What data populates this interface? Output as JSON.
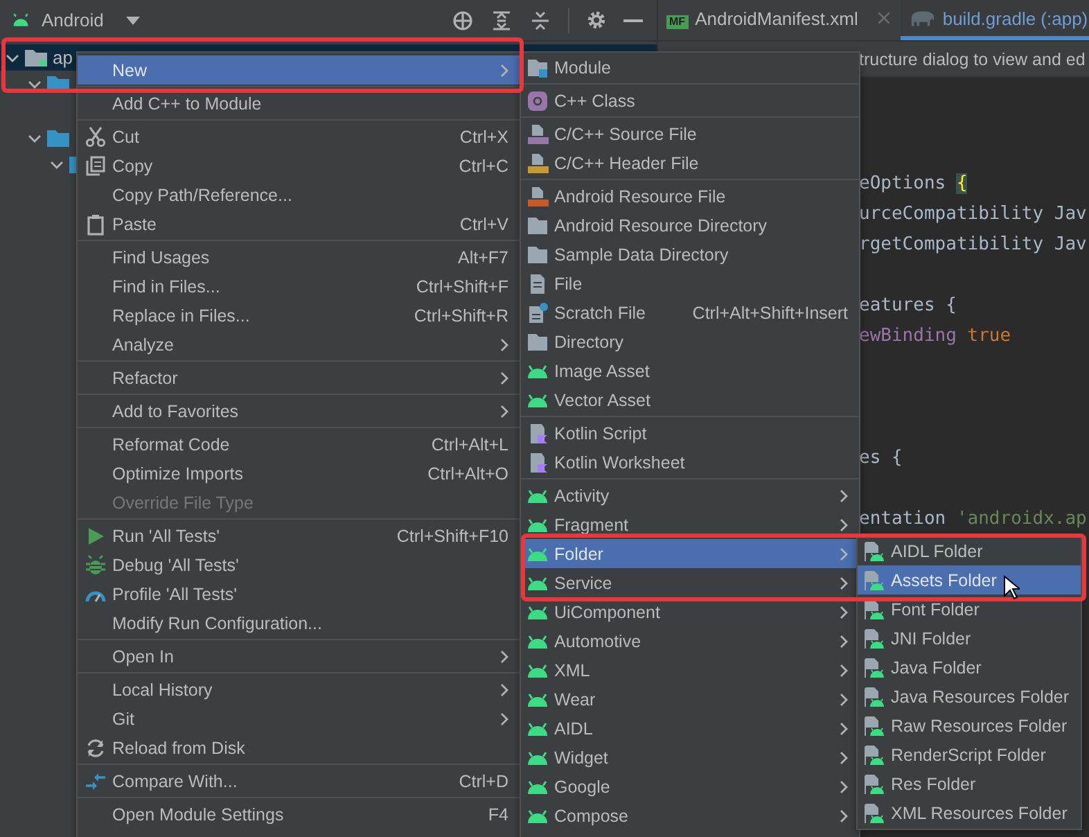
{
  "project_toolbar": {
    "view": "Android"
  },
  "editor_tabs": [
    {
      "label": "AndroidManifest.xml",
      "badge": "MF",
      "kind": "manifest",
      "selected": false
    },
    {
      "label": "build.gradle (:app)",
      "kind": "gradle",
      "selected": true
    }
  ],
  "project_tree": [
    {
      "label": "ap",
      "selected": true,
      "expanded": true,
      "children": [
        {
          "selected": false,
          "expanded": true
        },
        {
          "selected": false,
          "expanded": true,
          "children": [
            {
              "selected": false,
              "expanded": true
            }
          ]
        }
      ]
    }
  ],
  "editor_hint": "tructure dialog to view and ed",
  "code_lines": [
    {
      "kind": "blank"
    },
    {
      "kind": "blank"
    },
    {
      "kind": "blank"
    },
    {
      "kind": "code",
      "tokens": [
        {
          "text": "eOptions "
        },
        {
          "text": "{",
          "kind": "brace-match"
        }
      ]
    },
    {
      "kind": "code",
      "tokens": [
        {
          "text": "urceCompatibility Jav"
        }
      ]
    },
    {
      "kind": "code",
      "tokens": [
        {
          "text": "rgetCompatibility Jav"
        }
      ]
    },
    {
      "kind": "blank"
    },
    {
      "kind": "code",
      "tokens": [
        {
          "text": "eatures {"
        }
      ]
    },
    {
      "kind": "code",
      "tokens": [
        {
          "text": "ewBinding ",
          "kind": "property"
        },
        {
          "text": "true",
          "kind": "keyword"
        }
      ]
    },
    {
      "kind": "blank"
    },
    {
      "kind": "blank"
    },
    {
      "kind": "blank"
    },
    {
      "kind": "code",
      "tokens": [
        {
          "text": "es {"
        }
      ]
    },
    {
      "kind": "blank"
    },
    {
      "kind": "code",
      "tokens": [
        {
          "text": "entation "
        },
        {
          "text": "'androidx.ap",
          "kind": "string"
        }
      ]
    }
  ],
  "context_menu": {
    "groups": [
      [
        {
          "label": "New",
          "selected": true,
          "submenu": true,
          "disabled": false
        }
      ],
      [
        {
          "label": "Add C++ to Module",
          "selected": false,
          "submenu": false,
          "disabled": false
        }
      ],
      [
        {
          "label": "Cut",
          "shortcut": "Ctrl+X",
          "kind": "scissors",
          "selected": false,
          "submenu": false,
          "disabled": false
        },
        {
          "label": "Copy",
          "shortcut": "Ctrl+C",
          "kind": "copy",
          "selected": false,
          "submenu": false,
          "disabled": false
        },
        {
          "label": "Copy Path/Reference...",
          "selected": false,
          "submenu": false,
          "disabled": false
        },
        {
          "label": "Paste",
          "shortcut": "Ctrl+V",
          "kind": "paste",
          "selected": false,
          "submenu": false,
          "disabled": false
        }
      ],
      [
        {
          "label": "Find Usages",
          "shortcut": "Alt+F7",
          "selected": false,
          "submenu": false,
          "disabled": false
        },
        {
          "label": "Find in Files...",
          "shortcut": "Ctrl+Shift+F",
          "selected": false,
          "submenu": false,
          "disabled": false
        },
        {
          "label": "Replace in Files...",
          "shortcut": "Ctrl+Shift+R",
          "selected": false,
          "submenu": false,
          "disabled": false
        },
        {
          "label": "Analyze",
          "selected": false,
          "submenu": true,
          "disabled": false
        }
      ],
      [
        {
          "label": "Refactor",
          "selected": false,
          "submenu": true,
          "disabled": false
        }
      ],
      [
        {
          "label": "Add to Favorites",
          "selected": false,
          "submenu": true,
          "disabled": false
        }
      ],
      [
        {
          "label": "Reformat Code",
          "shortcut": "Ctrl+Alt+L",
          "selected": false,
          "submenu": false,
          "disabled": false
        },
        {
          "label": "Optimize Imports",
          "shortcut": "Ctrl+Alt+O",
          "selected": false,
          "submenu": false,
          "disabled": false
        },
        {
          "label": "Override File Type",
          "selected": false,
          "submenu": false,
          "disabled": true
        }
      ],
      [
        {
          "label": "Run 'All Tests'",
          "shortcut": "Ctrl+Shift+F10",
          "kind": "run",
          "selected": false,
          "submenu": false,
          "disabled": false
        },
        {
          "label": "Debug 'All Tests'",
          "kind": "debug",
          "selected": false,
          "submenu": false,
          "disabled": false
        },
        {
          "label": "Profile 'All Tests'",
          "kind": "profile",
          "selected": false,
          "submenu": false,
          "disabled": false
        },
        {
          "label": "Modify Run Configuration...",
          "selected": false,
          "submenu": false,
          "disabled": false
        }
      ],
      [
        {
          "label": "Open In",
          "selected": false,
          "submenu": true,
          "disabled": false
        }
      ],
      [
        {
          "label": "Local History",
          "selected": false,
          "submenu": true,
          "disabled": false
        },
        {
          "label": "Git",
          "selected": false,
          "submenu": true,
          "disabled": false
        },
        {
          "label": "Reload from Disk",
          "kind": "reload",
          "selected": false,
          "submenu": false,
          "disabled": false
        }
      ],
      [
        {
          "label": "Compare With...",
          "shortcut": "Ctrl+D",
          "kind": "compare",
          "selected": false,
          "submenu": false,
          "disabled": false
        }
      ],
      [
        {
          "label": "Open Module Settings",
          "shortcut": "F4",
          "selected": false,
          "submenu": false,
          "disabled": false
        }
      ]
    ]
  },
  "new_submenu": {
    "groups": [
      [
        {
          "label": "Module",
          "kind": "module",
          "selected": false,
          "submenu": false
        }
      ],
      [
        {
          "label": "C++ Class",
          "kind": "cpp-class",
          "selected": false,
          "submenu": false
        }
      ],
      [
        {
          "label": "C/C++ Source File",
          "kind": "cpp-source",
          "selected": false,
          "submenu": false
        },
        {
          "label": "C/C++ Header File",
          "kind": "cpp-header",
          "selected": false,
          "submenu": false
        }
      ],
      [
        {
          "label": "Android Resource File",
          "kind": "res-file",
          "selected": false,
          "submenu": false
        },
        {
          "label": "Android Resource Directory",
          "kind": "folder",
          "selected": false,
          "submenu": false
        },
        {
          "label": "Sample Data Directory",
          "kind": "folder",
          "selected": false,
          "submenu": false
        },
        {
          "label": "File",
          "kind": "file",
          "selected": false,
          "submenu": false
        },
        {
          "label": "Scratch File",
          "shortcut": "Ctrl+Alt+Shift+Insert",
          "kind": "scratch",
          "selected": false,
          "submenu": false
        },
        {
          "label": "Directory",
          "kind": "folder",
          "selected": false,
          "submenu": false
        },
        {
          "label": "Image Asset",
          "kind": "android",
          "selected": false,
          "submenu": false
        },
        {
          "label": "Vector Asset",
          "kind": "android",
          "selected": false,
          "submenu": false
        }
      ],
      [
        {
          "label": "Kotlin Script",
          "kind": "kotlin",
          "selected": false,
          "submenu": false
        },
        {
          "label": "Kotlin Worksheet",
          "kind": "kotlin",
          "selected": false,
          "submenu": false
        }
      ],
      [
        {
          "label": "Activity",
          "kind": "android",
          "selected": false,
          "submenu": true
        },
        {
          "label": "Fragment",
          "kind": "android",
          "selected": false,
          "submenu": true
        },
        {
          "label": "Folder",
          "kind": "android",
          "selected": true,
          "submenu": true
        },
        {
          "label": "Service",
          "kind": "android",
          "selected": false,
          "submenu": true
        },
        {
          "label": "UiComponent",
          "kind": "android",
          "selected": false,
          "submenu": true
        },
        {
          "label": "Automotive",
          "kind": "android",
          "selected": false,
          "submenu": true
        },
        {
          "label": "XML",
          "kind": "android",
          "selected": false,
          "submenu": true
        },
        {
          "label": "Wear",
          "kind": "android",
          "selected": false,
          "submenu": true
        },
        {
          "label": "AIDL",
          "kind": "android",
          "selected": false,
          "submenu": true
        },
        {
          "label": "Widget",
          "kind": "android",
          "selected": false,
          "submenu": true
        },
        {
          "label": "Google",
          "kind": "android",
          "selected": false,
          "submenu": true
        },
        {
          "label": "Compose",
          "kind": "android",
          "selected": false,
          "submenu": true
        }
      ]
    ]
  },
  "folder_submenu": {
    "groups": [
      [
        {
          "label": "AIDL Folder",
          "kind": "android-file",
          "selected": false
        },
        {
          "label": "Assets Folder",
          "kind": "android-file",
          "selected": true
        },
        {
          "label": "Font Folder",
          "kind": "android-file",
          "selected": false
        },
        {
          "label": "JNI Folder",
          "kind": "android-file",
          "selected": false
        },
        {
          "label": "Java Folder",
          "kind": "android-file",
          "selected": false
        },
        {
          "label": "Java Resources Folder",
          "kind": "android-file",
          "selected": false
        },
        {
          "label": "Raw Resources Folder",
          "kind": "android-file",
          "selected": false
        },
        {
          "label": "RenderScript Folder",
          "kind": "android-file",
          "selected": false
        },
        {
          "label": "Res Folder",
          "kind": "android-file",
          "selected": false
        },
        {
          "label": "XML Resources Folder",
          "kind": "android-file",
          "selected": false
        }
      ]
    ]
  }
}
